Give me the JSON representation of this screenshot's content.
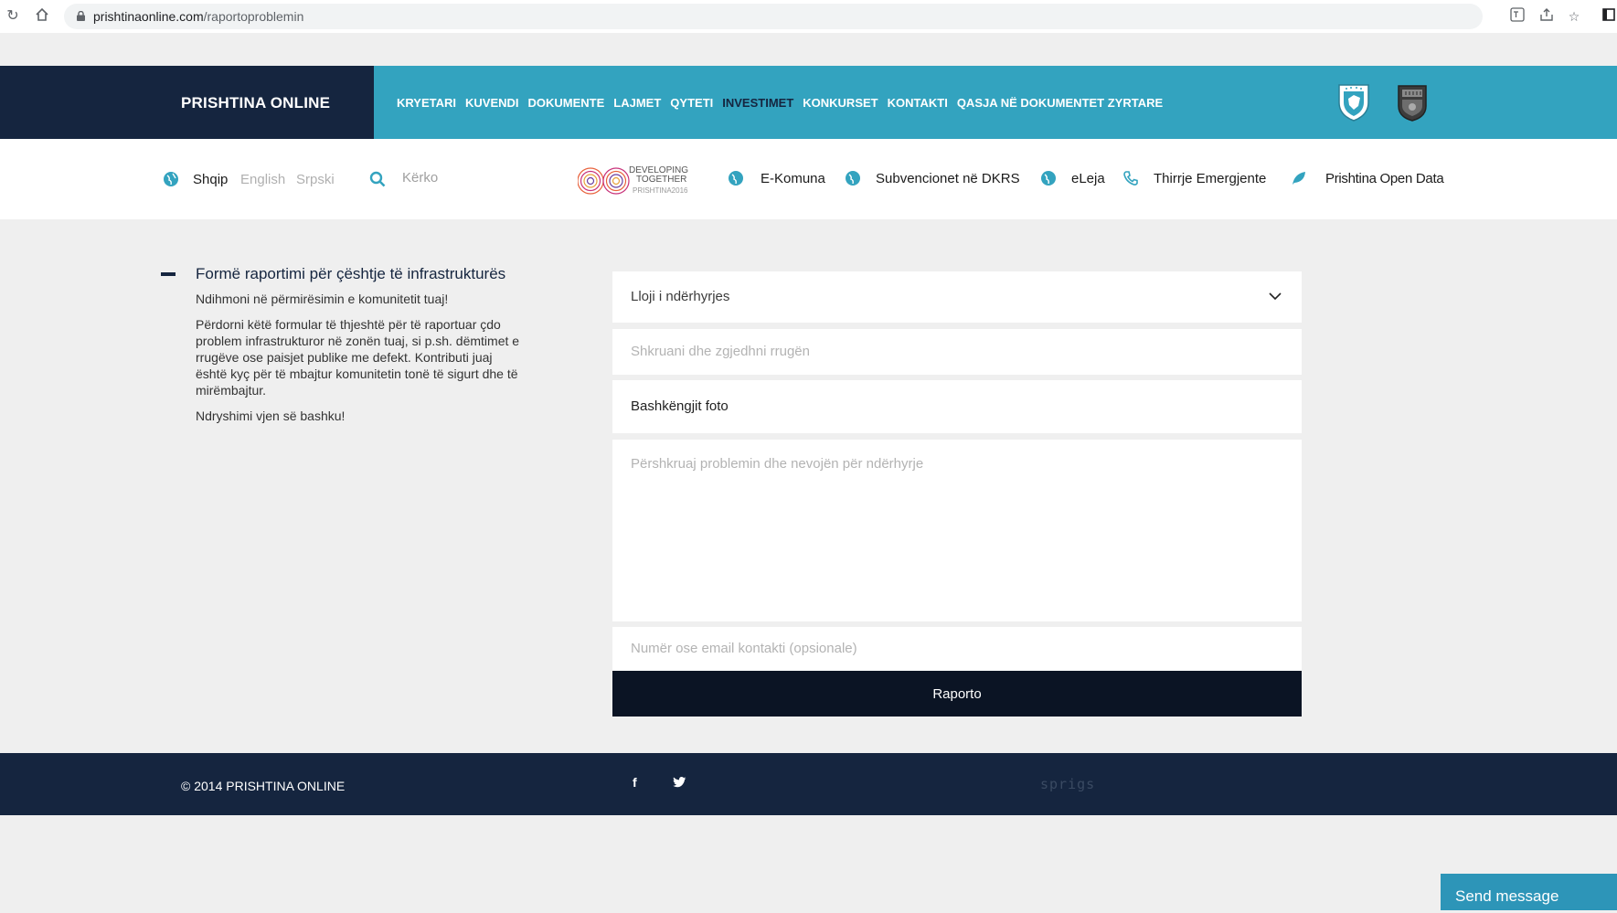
{
  "browser": {
    "url_domain": "prishtinaonline.com",
    "url_path": "/raportoproblemin"
  },
  "header": {
    "brand": "PRISHTINA ONLINE",
    "nav": [
      "KRYETARI",
      "KUVENDI",
      "DOKUMENTE",
      "LAJMET",
      "QYTETI",
      "INVESTIMET",
      "KONKURSET",
      "KONTAKTI",
      "QASJA NË DOKUMENTET ZYRTARE"
    ],
    "active_nav": "INVESTIMET",
    "colors": {
      "brand_bg": "#15253f",
      "nav_bg": "#33a3bf"
    }
  },
  "subbar": {
    "languages": [
      "Shqip",
      "English",
      "Srpski"
    ],
    "search_placeholder": "Kërko",
    "developing_logo": {
      "line1": "DEVELOPING",
      "line2": "TOGETHER",
      "line3": "PRISHTINA2016"
    },
    "quick_links": [
      "E-Komuna",
      "Subvencionet në DKRS",
      "eLeja",
      "Thirrje Emergjente",
      "Prishtina Open Data"
    ]
  },
  "content": {
    "title": "Formë raportimi për çështje të infrastrukturës",
    "para1": "Ndihmoni në përmirësimin e komunitetit tuaj!",
    "para2_lines": [
      "Përdorni këtë formular të thjeshtë për të raportuar çdo",
      "problem infrastrukturor në zonën tuaj, si p.sh. dëmtimet e",
      "rrugëve ose paisjet publike me defekt. Kontributi juaj",
      "është kyç për të mbajtur komunitetin tonë të sigurt dhe të",
      "mirëmbajtur."
    ],
    "para3": "Ndryshimi vjen së bashku!"
  },
  "form": {
    "type_select": "Lloji i ndërhyrjes",
    "street_placeholder": "Shkruani dhe zgjedhni rrugën",
    "photo_label": "Bashkëngjit foto",
    "description_placeholder": "Përshkruaj problemin dhe nevojën për ndërhyrje",
    "contact_placeholder": "Numër ose email kontakti (opsionale)",
    "submit": "Raporto"
  },
  "footer": {
    "copyright": "© 2014 PRISHTINA ONLINE",
    "facebook": "f",
    "credit": "sprigs"
  },
  "chat": {
    "label": "Send message"
  }
}
